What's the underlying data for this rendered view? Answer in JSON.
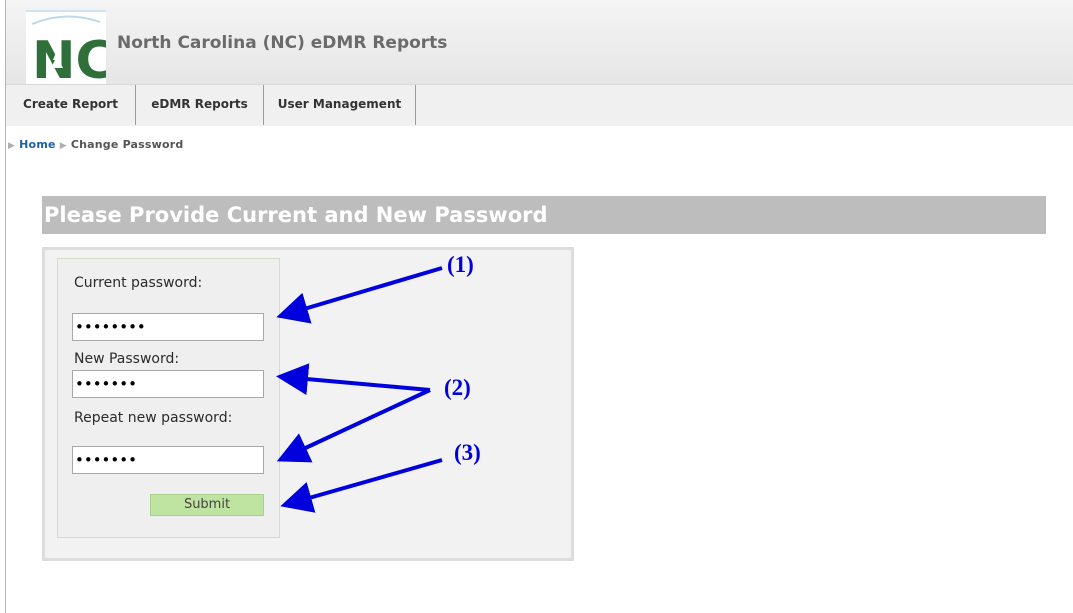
{
  "header": {
    "title": "North Carolina (NC) eDMR Reports",
    "logo_text": "NC"
  },
  "nav": {
    "items": [
      "Create Report",
      "eDMR Reports",
      "User Management"
    ]
  },
  "breadcrumb": {
    "home": "Home",
    "current": "Change Password"
  },
  "section": {
    "title": "Please Provide Current and New Password"
  },
  "form": {
    "current_label": "Current password:",
    "current_value": "••••••••",
    "new_label": "New Password:",
    "new_value": "•••••••",
    "repeat_label": "Repeat new password:",
    "repeat_value": "•••••••",
    "submit_label": "Submit"
  },
  "annotations": {
    "one": "(1)",
    "two": "(2)",
    "three": "(3)"
  },
  "colors": {
    "annotation": "#0000dd",
    "title_bar": "#bdbdbd",
    "submit": "#bfe3a0"
  }
}
